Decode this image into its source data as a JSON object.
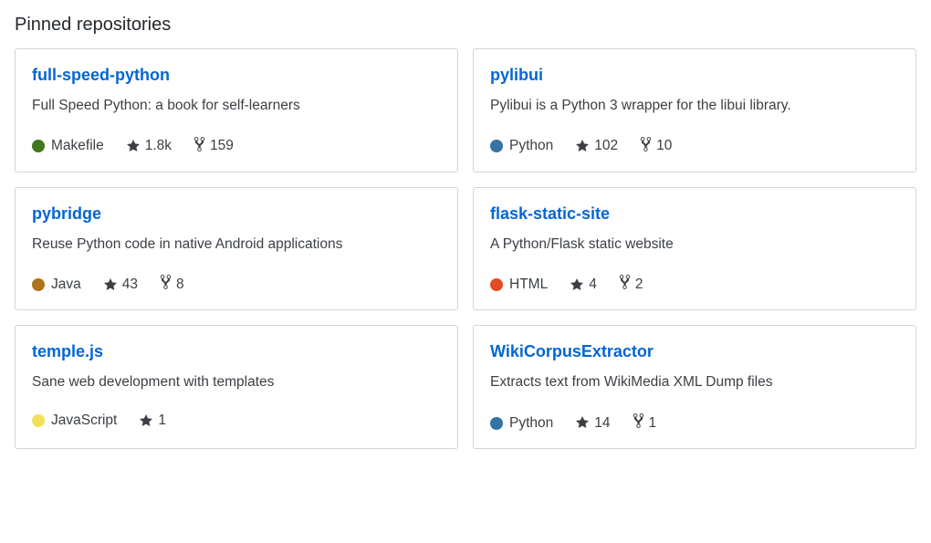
{
  "section_title": "Pinned repositories",
  "language_colors": {
    "Makefile": "#427819",
    "Python": "#3572A5",
    "Java": "#b07219",
    "HTML": "#e34c26",
    "JavaScript": "#f1e05a"
  },
  "repos": [
    {
      "name": "full-speed-python",
      "description": "Full Speed Python: a book for self-learners",
      "language": "Makefile",
      "stars": "1.8k",
      "forks": "159"
    },
    {
      "name": "pylibui",
      "description": "Pylibui is a Python 3 wrapper for the libui library.",
      "language": "Python",
      "stars": "102",
      "forks": "10"
    },
    {
      "name": "pybridge",
      "description": "Reuse Python code in native Android applications",
      "language": "Java",
      "stars": "43",
      "forks": "8"
    },
    {
      "name": "flask-static-site",
      "description": "A Python/Flask static website",
      "language": "HTML",
      "stars": "4",
      "forks": "2"
    },
    {
      "name": "temple.js",
      "description": "Sane web development with templates",
      "language": "JavaScript",
      "stars": "1",
      "forks": null
    },
    {
      "name": "WikiCorpusExtractor",
      "description": "Extracts text from WikiMedia XML Dump files",
      "language": "Python",
      "stars": "14",
      "forks": "1"
    }
  ]
}
